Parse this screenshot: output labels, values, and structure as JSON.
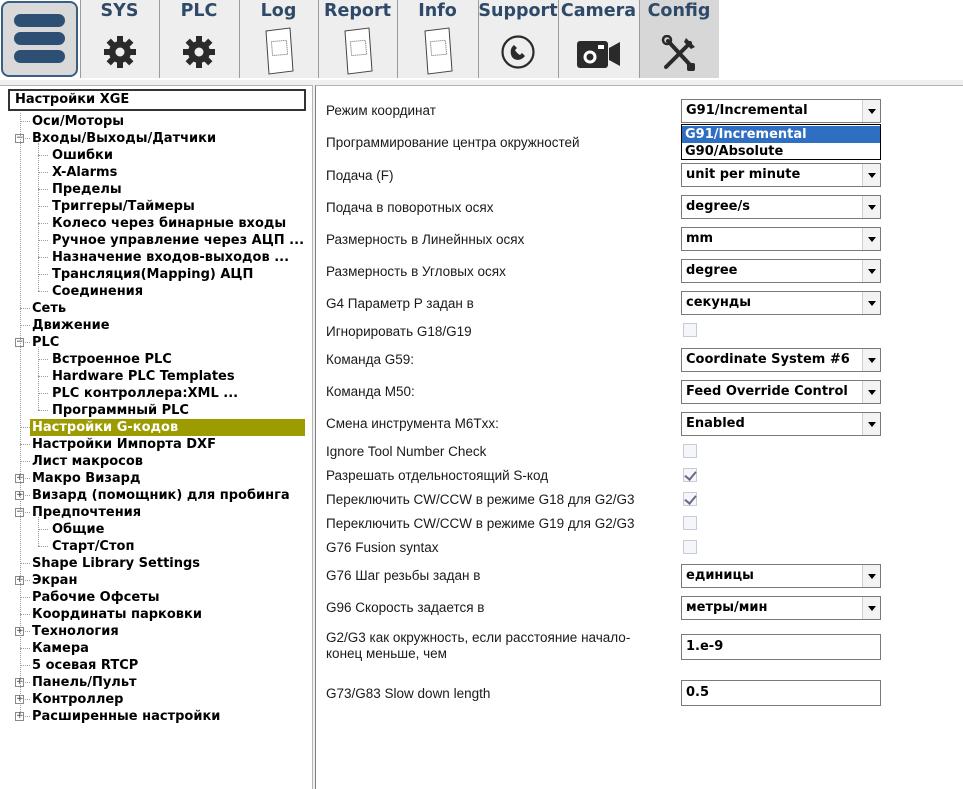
{
  "toolbar": {
    "items": [
      {
        "label": "SYS",
        "icon": "gear-icon"
      },
      {
        "label": "PLC",
        "icon": "gear-icon"
      },
      {
        "label": "Log",
        "icon": "document-icon"
      },
      {
        "label": "Report",
        "icon": "document-icon"
      },
      {
        "label": "Info",
        "icon": "document-icon"
      },
      {
        "label": "Support",
        "icon": "phone-icon"
      },
      {
        "label": "Camera",
        "icon": "camera-icon"
      },
      {
        "label": "Config",
        "icon": "tools-icon"
      }
    ],
    "active": "Config",
    "accent": "#2e4a68"
  },
  "tree": {
    "header": "Настройки XGE",
    "items": [
      {
        "label": "Оси/Моторы",
        "level": 1,
        "expander": ""
      },
      {
        "label": "Входы/Выходы/Датчики",
        "level": 1,
        "expander": "−"
      },
      {
        "label": "Ошибки",
        "level": 2,
        "expander": ""
      },
      {
        "label": "X-Alarms",
        "level": 2,
        "expander": ""
      },
      {
        "label": "Пределы",
        "level": 2,
        "expander": ""
      },
      {
        "label": "Триггеры/Таймеры",
        "level": 2,
        "expander": ""
      },
      {
        "label": "Колесо через бинарные входы",
        "level": 2,
        "expander": ""
      },
      {
        "label": "Ручное управление через АЦП ...",
        "level": 2,
        "expander": ""
      },
      {
        "label": "Назначение входов-выходов ...",
        "level": 2,
        "expander": ""
      },
      {
        "label": "Трансляция(Mapping) АЦП",
        "level": 2,
        "expander": ""
      },
      {
        "label": "Соединения",
        "level": 2,
        "expander": ""
      },
      {
        "label": "Сеть",
        "level": 1,
        "expander": ""
      },
      {
        "label": "Движение",
        "level": 1,
        "expander": ""
      },
      {
        "label": "PLC",
        "level": 1,
        "expander": "−"
      },
      {
        "label": "Встроенное PLC",
        "level": 2,
        "expander": ""
      },
      {
        "label": "Hardware PLC Templates",
        "level": 2,
        "expander": ""
      },
      {
        "label": "PLC контроллера:XML ...",
        "level": 2,
        "expander": ""
      },
      {
        "label": "Программный PLC",
        "level": 2,
        "expander": ""
      },
      {
        "label": "Настройки G-кодов",
        "level": 1,
        "expander": "",
        "selected": true
      },
      {
        "label": "Настройки Импорта DXF",
        "level": 1,
        "expander": ""
      },
      {
        "label": "Лист макросов",
        "level": 1,
        "expander": ""
      },
      {
        "label": "Макро Визард",
        "level": 1,
        "expander": "+"
      },
      {
        "label": "Визард (помощник) для пробинга",
        "level": 1,
        "expander": "+"
      },
      {
        "label": "Предпочтения",
        "level": 1,
        "expander": "−"
      },
      {
        "label": "Общие",
        "level": 2,
        "expander": ""
      },
      {
        "label": "Старт/Стоп",
        "level": 2,
        "expander": ""
      },
      {
        "label": "Shape Library Settings",
        "level": 1,
        "expander": ""
      },
      {
        "label": "Экран",
        "level": 1,
        "expander": "+"
      },
      {
        "label": "Рабочие Офсеты",
        "level": 1,
        "expander": ""
      },
      {
        "label": "Координаты парковки",
        "level": 1,
        "expander": ""
      },
      {
        "label": "Технология",
        "level": 1,
        "expander": "+"
      },
      {
        "label": "Камера",
        "level": 1,
        "expander": ""
      },
      {
        "label": "5 осевая RTCP",
        "level": 1,
        "expander": ""
      },
      {
        "label": "Панель/Пульт",
        "level": 1,
        "expander": "+"
      },
      {
        "label": "Контроллер",
        "level": 1,
        "expander": "+"
      },
      {
        "label": "Расширенные настройки",
        "level": 1,
        "expander": "+"
      }
    ],
    "selected_color": "#9c9c00"
  },
  "settings": {
    "rows": [
      {
        "label": "Режим координат",
        "control": "combo",
        "value": "G91/Incremental"
      },
      {
        "label": "Программирование центра окружностей",
        "control": "combo",
        "value": ""
      },
      {
        "label": "Подача (F)",
        "control": "combo",
        "value": "unit per minute"
      },
      {
        "label": "Подача в поворотных осях",
        "control": "combo",
        "value": "degree/s"
      },
      {
        "label": "Размерность в Линейнных осях",
        "control": "combo",
        "value": "mm"
      },
      {
        "label": "Размерность в Угловых осях",
        "control": "combo",
        "value": "degree"
      },
      {
        "label": "G4 Параметр P задан в",
        "control": "combo",
        "value": "секунды"
      },
      {
        "label": "Игнорировать G18/G19",
        "control": "checkbox",
        "checked": false
      },
      {
        "label": "Команда G59:",
        "control": "combo",
        "value": "Coordinate System #6"
      },
      {
        "label": "Команда M50:",
        "control": "combo",
        "value": "Feed Override Control"
      },
      {
        "label": "Смена инструмента M6Txx:",
        "control": "combo",
        "value": "Enabled"
      },
      {
        "label": "Ignore Tool Number Check",
        "control": "checkbox",
        "checked": false
      },
      {
        "label": "Разрешать отдельностоящий S-код",
        "control": "checkbox",
        "checked": true
      },
      {
        "label": "Переключить CW/CCW в режиме G18 для G2/G3",
        "control": "checkbox",
        "checked": true
      },
      {
        "label": "Переключить CW/CCW в режиме G19 для G2/G3",
        "control": "checkbox",
        "checked": false
      },
      {
        "label": "G76 Fusion syntax",
        "control": "checkbox",
        "checked": false
      },
      {
        "label": "G76 Шаг резьбы задан в",
        "control": "combo",
        "value": "единицы"
      },
      {
        "label": "G96 Скорость задается в",
        "control": "combo",
        "value": "метры/мин"
      },
      {
        "label": "G2/G3 как окружность, если расстояние начало-конец меньше, чем",
        "control": "text",
        "value": "1.e-9"
      },
      {
        "label": "G73/G83 Slow down length",
        "control": "text",
        "value": "0.5"
      }
    ],
    "dropdown": {
      "options": [
        "G91/Incremental",
        "G90/Absolute"
      ],
      "highlighted": "G91/Incremental",
      "highlight_color": "#2f6fc2"
    }
  }
}
